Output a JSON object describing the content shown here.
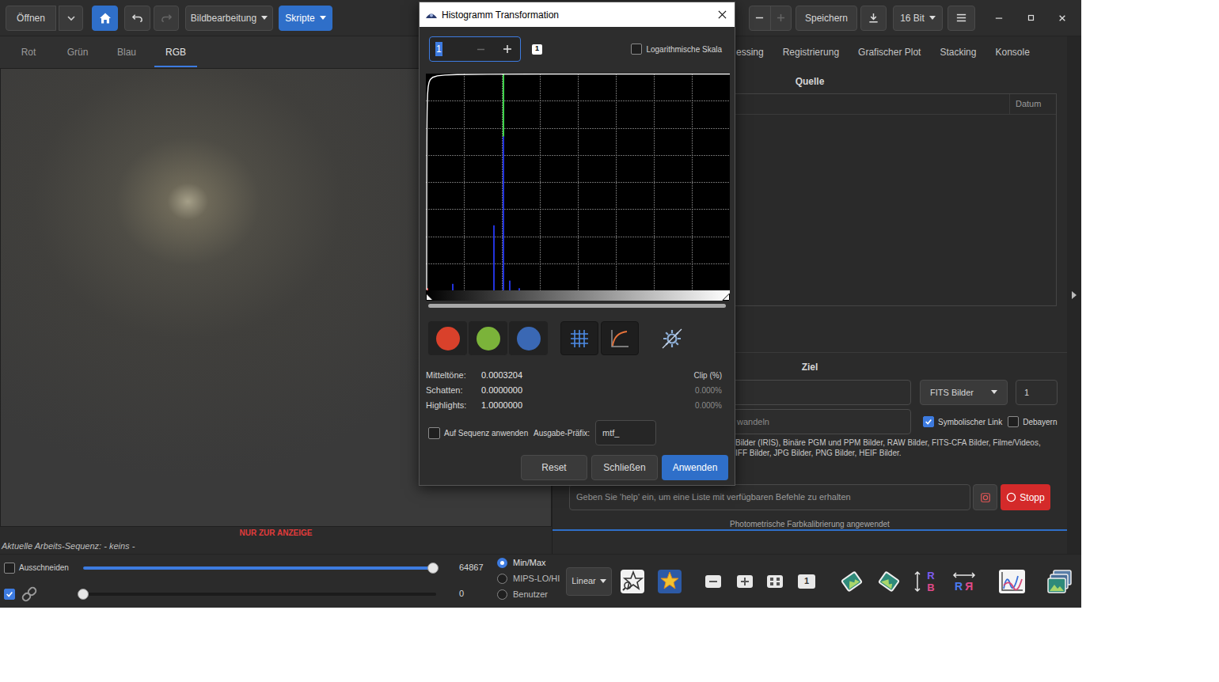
{
  "toolbar": {
    "open": "Öffnen",
    "home": {
      "highlighted": true
    },
    "undo": {
      "disabled": false
    },
    "redo": {
      "disabled": true
    },
    "image_processing": "Bildbearbeitung",
    "scripts": {
      "label": "Skripte",
      "highlighted": true
    },
    "zoom_out": {
      "disabled": false
    },
    "zoom_in": {
      "disabled": true
    },
    "save": "Speichern",
    "bit_depth": "16 Bit"
  },
  "channel_tabs": [
    {
      "label": "Rot",
      "selected": false
    },
    {
      "label": "Grün",
      "selected": false
    },
    {
      "label": "Blau",
      "selected": false
    },
    {
      "label": "RGB",
      "selected": true
    }
  ],
  "image": {
    "display_only": "NUR ZUR ANZEIGE"
  },
  "sequence": "Aktuelle Arbeits-Sequenz: - keins -",
  "display": {
    "crop": {
      "label": "Ausschneiden",
      "checked": false
    },
    "high": {
      "level": 0.99,
      "reading": "64867"
    },
    "link": {
      "checked": true
    },
    "low": {
      "level": 0,
      "reading": "0"
    },
    "modes": [
      {
        "label": "Min/Max",
        "selected": true
      },
      {
        "label": "MIPS-LO/HI",
        "selected": false
      },
      {
        "label": "Benutzer",
        "selected": false
      }
    ],
    "scale": "Linear"
  },
  "tools": [
    {
      "kind": "starfind"
    },
    {
      "kind": "pcc"
    },
    {
      "kind": "zoomout"
    },
    {
      "kind": "zoomin"
    },
    {
      "kind": "fit"
    },
    {
      "kind": "onetoone",
      "letters": [
        "1"
      ]
    },
    {
      "kind": "rotleft"
    },
    {
      "kind": "rotright"
    },
    {
      "kind": "mirror",
      "letters": [
        "R",
        "B"
      ]
    },
    {
      "kind": "flip",
      "letters": [
        "R",
        "R"
      ]
    },
    {
      "kind": "plot"
    },
    {
      "kind": "gallery"
    }
  ],
  "right_tabs": [
    {
      "label": "essing",
      "selected": false
    },
    {
      "label": "Registrierung",
      "selected": false
    },
    {
      "label": "Grafischer Plot",
      "selected": false
    },
    {
      "label": "Stacking",
      "selected": false
    },
    {
      "label": "Konsole",
      "selected": false
    }
  ],
  "source": {
    "title": "Quelle",
    "columns": [
      "Datum"
    ]
  },
  "target": {
    "title": "Ziel",
    "format": "FITS Bilder",
    "start": "1",
    "convert": "wandeln",
    "symlink": {
      "label": "Symbolischer Link",
      "checked": true
    },
    "debayer": {
      "label": "Debayern",
      "checked": false
    },
    "info_lines": [
      "Bilder (IRIS), Binäre PGM und PPM Bilder, RAW Bilder, FITS-CFA Bilder, Filme/Videos,",
      "IFF Bilder, JPG Bilder, PNG Bilder, HEIF Bilder."
    ]
  },
  "console": {
    "placeholder": "Geben Sie 'help' ein, um eine Liste mit verfügbaren Befehle zu erhalten",
    "stop": "Stopp"
  },
  "status_bar": "Photometrische Farbkalibrierung angewendet",
  "dialog": {
    "title": "Histogramm Transformation",
    "zoom": {
      "value": "1",
      "minus": {
        "disabled": true
      },
      "plus": {
        "disabled": false
      },
      "reset": "1"
    },
    "log_scale": {
      "label": "Logarithmische Skala",
      "checked": false
    },
    "histogram": {
      "series": [
        {
          "color": "#e23b3b",
          "values": [
            0.01,
            0,
            0,
            0,
            0,
            0,
            0,
            0,
            0,
            0,
            0,
            0,
            0,
            0,
            0,
            0,
            0,
            0,
            0,
            0,
            0,
            0,
            0,
            0,
            0,
            0,
            0,
            0,
            0,
            0,
            0,
            0,
            0,
            0,
            0,
            0,
            0,
            0,
            0,
            0,
            0,
            0,
            0,
            0,
            0,
            0,
            0,
            0,
            0,
            0,
            0,
            0,
            0,
            0,
            0,
            0,
            0,
            0,
            0,
            0,
            0,
            0,
            0,
            0,
            0,
            0,
            0,
            0,
            0,
            0,
            0,
            0,
            0,
            0,
            0,
            0,
            0,
            0,
            0,
            0,
            0,
            0,
            0,
            0,
            0,
            0,
            0,
            0,
            0,
            0,
            0,
            0,
            0,
            0,
            0,
            0
          ]
        },
        {
          "color": "#3fd24a",
          "values": [
            0,
            0,
            0,
            0,
            0,
            0,
            0,
            0,
            0,
            0,
            0,
            0,
            0,
            0,
            0,
            0,
            0,
            0,
            0,
            0,
            0,
            0,
            0,
            0,
            1,
            0,
            0,
            0,
            0,
            0,
            0,
            0,
            0,
            0,
            0,
            0,
            0,
            0,
            0,
            0,
            0,
            0,
            0,
            0,
            0,
            0,
            0,
            0,
            0,
            0,
            0,
            0,
            0,
            0,
            0,
            0,
            0,
            0,
            0,
            0,
            0,
            0,
            0,
            0,
            0,
            0,
            0,
            0,
            0,
            0,
            0,
            0,
            0,
            0,
            0,
            0,
            0,
            0,
            0,
            0,
            0,
            0,
            0,
            0,
            0,
            0,
            0,
            0,
            0,
            0,
            0,
            0,
            0,
            0,
            0,
            0
          ]
        },
        {
          "color": "#2233dd",
          "values": [
            0,
            0,
            0,
            0,
            0,
            0,
            0,
            0,
            0.03,
            0,
            0,
            0,
            0,
            0,
            0,
            0,
            0,
            0,
            0,
            0,
            0,
            0.3,
            0,
            0,
            0.71,
            0,
            0.045,
            0,
            0,
            0.01,
            0,
            0,
            0,
            0,
            0,
            0,
            0,
            0,
            0,
            0,
            0,
            0,
            0,
            0,
            0,
            0,
            0,
            0,
            0,
            0,
            0,
            0,
            0,
            0,
            0,
            0,
            0,
            0,
            0,
            0,
            0,
            0,
            0,
            0,
            0,
            0,
            0,
            0,
            0,
            0,
            0,
            0,
            0,
            0,
            0,
            0,
            0,
            0,
            0,
            0,
            0,
            0,
            0,
            0,
            0,
            0,
            0,
            0,
            0,
            0,
            0,
            0,
            0,
            0,
            0,
            0
          ]
        }
      ]
    },
    "channels": [
      {
        "selected": true,
        "color": "#d9412b"
      },
      {
        "selected": true,
        "color": "#7bb33a"
      },
      {
        "selected": true,
        "color": "#3a68b4"
      }
    ],
    "grid": {
      "selected": true
    },
    "curve": {
      "selected": true
    },
    "stats": [
      {
        "label": "Mitteltöne:",
        "value": "0.0003204"
      },
      {
        "label": "Schatten:",
        "value": "0.0000000",
        "clip": "0.000%"
      },
      {
        "label": "Highlights:",
        "value": "1.0000000",
        "clip": "0.000%"
      }
    ],
    "clip_header": "Clip (%)",
    "apply_to_sequence": {
      "label": "Auf Sequenz anwenden",
      "checked": false
    },
    "prefix": {
      "label": "Ausgabe-Präfix:",
      "value": "mtf_"
    },
    "buttons": [
      {
        "label": "Reset",
        "primary": false
      },
      {
        "label": "Schließen",
        "primary": false
      },
      {
        "label": "Anwenden",
        "primary": true
      }
    ]
  }
}
